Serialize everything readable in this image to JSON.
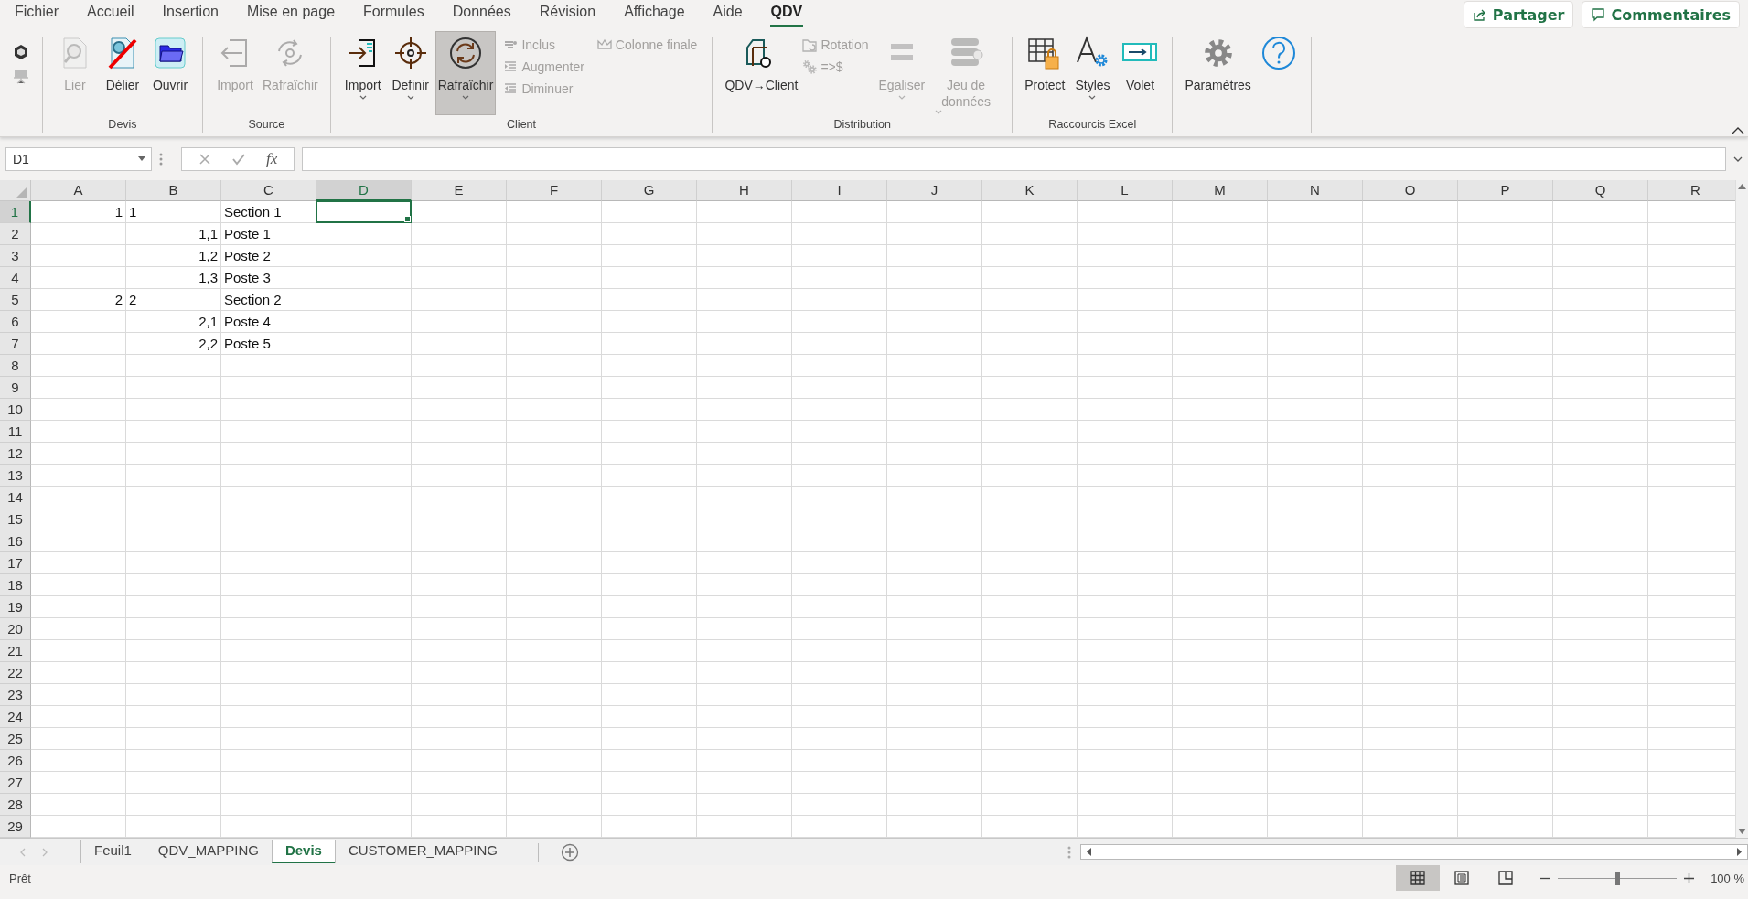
{
  "menu_tabs": [
    {
      "label": "Fichier",
      "selected": false
    },
    {
      "label": "Accueil",
      "selected": false
    },
    {
      "label": "Insertion",
      "selected": false
    },
    {
      "label": "Mise en page",
      "selected": false
    },
    {
      "label": "Formules",
      "selected": false
    },
    {
      "label": "Données",
      "selected": false
    },
    {
      "label": "Révision",
      "selected": false
    },
    {
      "label": "Affichage",
      "selected": false
    },
    {
      "label": "Aide",
      "selected": false
    },
    {
      "label": "QDV",
      "selected": true
    }
  ],
  "share_button": {
    "label": "Partager"
  },
  "comments_button": {
    "label": "Commentaires"
  },
  "ribbon": {
    "groups": [
      {
        "label": "Devis",
        "columns": [
          {
            "kind": "large",
            "label": "Lier",
            "disabled": true
          },
          {
            "kind": "large",
            "label": "Délier",
            "disabled": false
          },
          {
            "kind": "large",
            "label": "Ouvrir",
            "disabled": false
          }
        ]
      },
      {
        "label": "Source",
        "columns": [
          {
            "kind": "large",
            "label": "Import",
            "disabled": true
          },
          {
            "kind": "large",
            "label": "Rafraîchir",
            "disabled": true
          }
        ]
      },
      {
        "label": "Client",
        "columns": [
          {
            "kind": "large",
            "label": "Import",
            "disabled": false,
            "dropdown": true
          },
          {
            "kind": "large",
            "label": "Definir",
            "disabled": false,
            "dropdown": true
          },
          {
            "kind": "large",
            "label": "Rafraîchir",
            "disabled": false,
            "dropdown": true,
            "pressed": true
          },
          {
            "kind": "stack",
            "items": [
              {
                "label": "Inclus",
                "disabled": true
              },
              {
                "label": "Augmenter",
                "disabled": true
              },
              {
                "label": "Diminuer",
                "disabled": true
              }
            ]
          },
          {
            "kind": "stack",
            "items": [
              {
                "label": "Colonne finale",
                "disabled": true
              }
            ]
          }
        ]
      },
      {
        "label": "Distribution",
        "columns": [
          {
            "kind": "large",
            "label": "QDV→Client",
            "disabled": false
          },
          {
            "kind": "stack",
            "items": [
              {
                "label": "Rotation",
                "disabled": true
              },
              {
                "label": "=>$",
                "disabled": true
              }
            ]
          },
          {
            "kind": "large",
            "label": "Egaliser",
            "disabled": true,
            "dropdown": true
          },
          {
            "kind": "large",
            "label": "Jeu de données",
            "disabled": true,
            "dropdown": true
          }
        ]
      },
      {
        "label": "Raccourcis Excel",
        "columns": [
          {
            "kind": "large",
            "label": "Protect",
            "disabled": false
          },
          {
            "kind": "large",
            "label": "Styles",
            "disabled": false,
            "dropdown": true
          },
          {
            "kind": "large",
            "label": "Volet",
            "disabled": false
          }
        ]
      },
      {
        "columns": [
          {
            "kind": "large",
            "label": "Paramètres",
            "disabled": false
          },
          {
            "kind": "large",
            "disabled": false
          }
        ]
      }
    ]
  },
  "formula_bar": {
    "name_box": "D1",
    "function_button": "fx"
  },
  "columns": [
    {
      "label": "A",
      "selected": false
    },
    {
      "label": "B",
      "selected": false
    },
    {
      "label": "C",
      "selected": false
    },
    {
      "label": "D",
      "selected": true
    },
    {
      "label": "E",
      "selected": false
    },
    {
      "label": "F",
      "selected": false
    },
    {
      "label": "G",
      "selected": false
    },
    {
      "label": "H",
      "selected": false
    },
    {
      "label": "I",
      "selected": false
    },
    {
      "label": "J",
      "selected": false
    },
    {
      "label": "K",
      "selected": false
    },
    {
      "label": "L",
      "selected": false
    },
    {
      "label": "M",
      "selected": false
    },
    {
      "label": "N",
      "selected": false
    },
    {
      "label": "O",
      "selected": false
    },
    {
      "label": "P",
      "selected": false
    },
    {
      "label": "Q",
      "selected": false
    },
    {
      "label": "R",
      "selected": false
    }
  ],
  "rows": [
    {
      "number": "1",
      "selected": true,
      "cells": [
        {
          "text": "1",
          "right_aligned": true
        },
        {
          "text": "1",
          "right_aligned": false
        },
        {
          "text": "Section 1",
          "right_aligned": false
        }
      ]
    },
    {
      "number": "2",
      "selected": false,
      "cells": [
        null,
        {
          "text": "1,1",
          "right_aligned": true
        },
        {
          "text": "Poste 1",
          "right_aligned": false
        }
      ]
    },
    {
      "number": "3",
      "selected": false,
      "cells": [
        null,
        {
          "text": "1,2",
          "right_aligned": true
        },
        {
          "text": "Poste 2",
          "right_aligned": false
        }
      ]
    },
    {
      "number": "4",
      "selected": false,
      "cells": [
        null,
        {
          "text": "1,3",
          "right_aligned": true
        },
        {
          "text": "Poste 3",
          "right_aligned": false
        }
      ]
    },
    {
      "number": "5",
      "selected": false,
      "cells": [
        {
          "text": "2",
          "right_aligned": true
        },
        {
          "text": "2",
          "right_aligned": false
        },
        {
          "text": "Section 2",
          "right_aligned": false
        }
      ]
    },
    {
      "number": "6",
      "selected": false,
      "cells": [
        null,
        {
          "text": "2,1",
          "right_aligned": true
        },
        {
          "text": "Poste 4",
          "right_aligned": false
        }
      ]
    },
    {
      "number": "7",
      "selected": false,
      "cells": [
        null,
        {
          "text": "2,2",
          "right_aligned": true
        },
        {
          "text": "Poste 5",
          "right_aligned": false
        }
      ]
    },
    {
      "number": "8",
      "selected": false
    },
    {
      "number": "9",
      "selected": false
    },
    {
      "number": "10",
      "selected": false
    },
    {
      "number": "11",
      "selected": false
    },
    {
      "number": "12",
      "selected": false
    },
    {
      "number": "13",
      "selected": false
    },
    {
      "number": "14",
      "selected": false
    },
    {
      "number": "15",
      "selected": false
    },
    {
      "number": "16",
      "selected": false
    },
    {
      "number": "17",
      "selected": false
    },
    {
      "number": "18",
      "selected": false
    },
    {
      "number": "19",
      "selected": false
    },
    {
      "number": "20",
      "selected": false
    },
    {
      "number": "21",
      "selected": false
    },
    {
      "number": "22",
      "selected": false
    },
    {
      "number": "23",
      "selected": false
    },
    {
      "number": "24",
      "selected": false
    },
    {
      "number": "25",
      "selected": false
    },
    {
      "number": "26",
      "selected": false
    },
    {
      "number": "27",
      "selected": false
    },
    {
      "number": "28",
      "selected": false
    },
    {
      "number": "29",
      "selected": false
    }
  ],
  "sheet_tabs": [
    {
      "label": "Feuil1",
      "selected": false
    },
    {
      "label": "QDV_MAPPING",
      "selected": false
    },
    {
      "label": "Devis",
      "selected": true
    },
    {
      "label": "CUSTOMER_MAPPING",
      "selected": false
    }
  ],
  "status_bar": {
    "text": "Prêt",
    "views": [
      {
        "selected": true
      },
      {
        "selected": false
      },
      {
        "selected": false
      }
    ],
    "zoom": {
      "level": 0.5,
      "label": "100 %"
    }
  }
}
